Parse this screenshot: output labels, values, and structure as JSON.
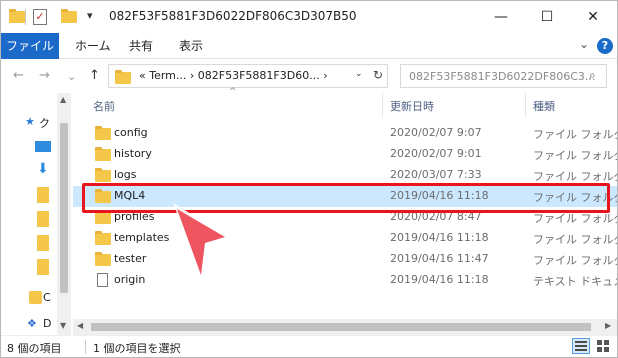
{
  "window": {
    "title": "082F53F5881F3D6022DF806C3D307B50",
    "minimize_glyph": "—",
    "maximize_glyph": "☐",
    "close_glyph": "✕",
    "qat_pin_glyph": "▾"
  },
  "ribbon": {
    "tabs": [
      "ファイル",
      "ホーム",
      "共有",
      "表示"
    ],
    "collapse_glyph": "⌄",
    "help_glyph": "?"
  },
  "address": {
    "back_glyph": "←",
    "forward_glyph": "→",
    "recent_glyph": "⌄",
    "up_glyph": "↑",
    "breadcrumb": "« Term...  ›  082F53F5881F3D60...  ›",
    "dropdown_glyph": "⌄",
    "refresh_glyph": "↻",
    "search_placeholder": "082F53F5881F3D6022DF806C3...",
    "search_glyph": "⌕"
  },
  "nav_pane": {
    "items": [
      "ク",
      "",
      "",
      "",
      "",
      "",
      ""
    ],
    "bottom_items": [
      "C",
      "D"
    ]
  },
  "columns": {
    "name": "名前",
    "modified": "更新日時",
    "type": "種類"
  },
  "files": [
    {
      "name": "config",
      "date": "2020/02/07 9:07",
      "type": "ファイル フォルダー",
      "icon": "folder-icon"
    },
    {
      "name": "history",
      "date": "2020/02/07 9:01",
      "type": "ファイル フォルダー",
      "icon": "folder-icon"
    },
    {
      "name": "logs",
      "date": "2020/03/07 7:33",
      "type": "ファイル フォルダー",
      "icon": "folder-icon"
    },
    {
      "name": "MQL4",
      "date": "2019/04/16 11:18",
      "type": "ファイル フォルダー",
      "icon": "folder-icon",
      "selected": true
    },
    {
      "name": "profiles",
      "date": "2020/02/07 8:47",
      "type": "ファイル フォルダー",
      "icon": "folder-icon"
    },
    {
      "name": "templates",
      "date": "2019/04/16 11:18",
      "type": "ファイル フォルダー",
      "icon": "folder-icon"
    },
    {
      "name": "tester",
      "date": "2019/04/16 11:47",
      "type": "ファイル フォルダー",
      "icon": "folder-icon"
    },
    {
      "name": "origin",
      "date": "2019/04/16 11:18",
      "type": "テキスト ドキュメント",
      "icon": "text-document-icon"
    }
  ],
  "status": {
    "item_count": "8 個の項目",
    "selected_count": "1 個の項目を選択"
  },
  "colors": {
    "accent": "#1b6ac9",
    "selection": "#cce8ff",
    "highlight": "#e8141e",
    "folder": "#f4c74b"
  }
}
